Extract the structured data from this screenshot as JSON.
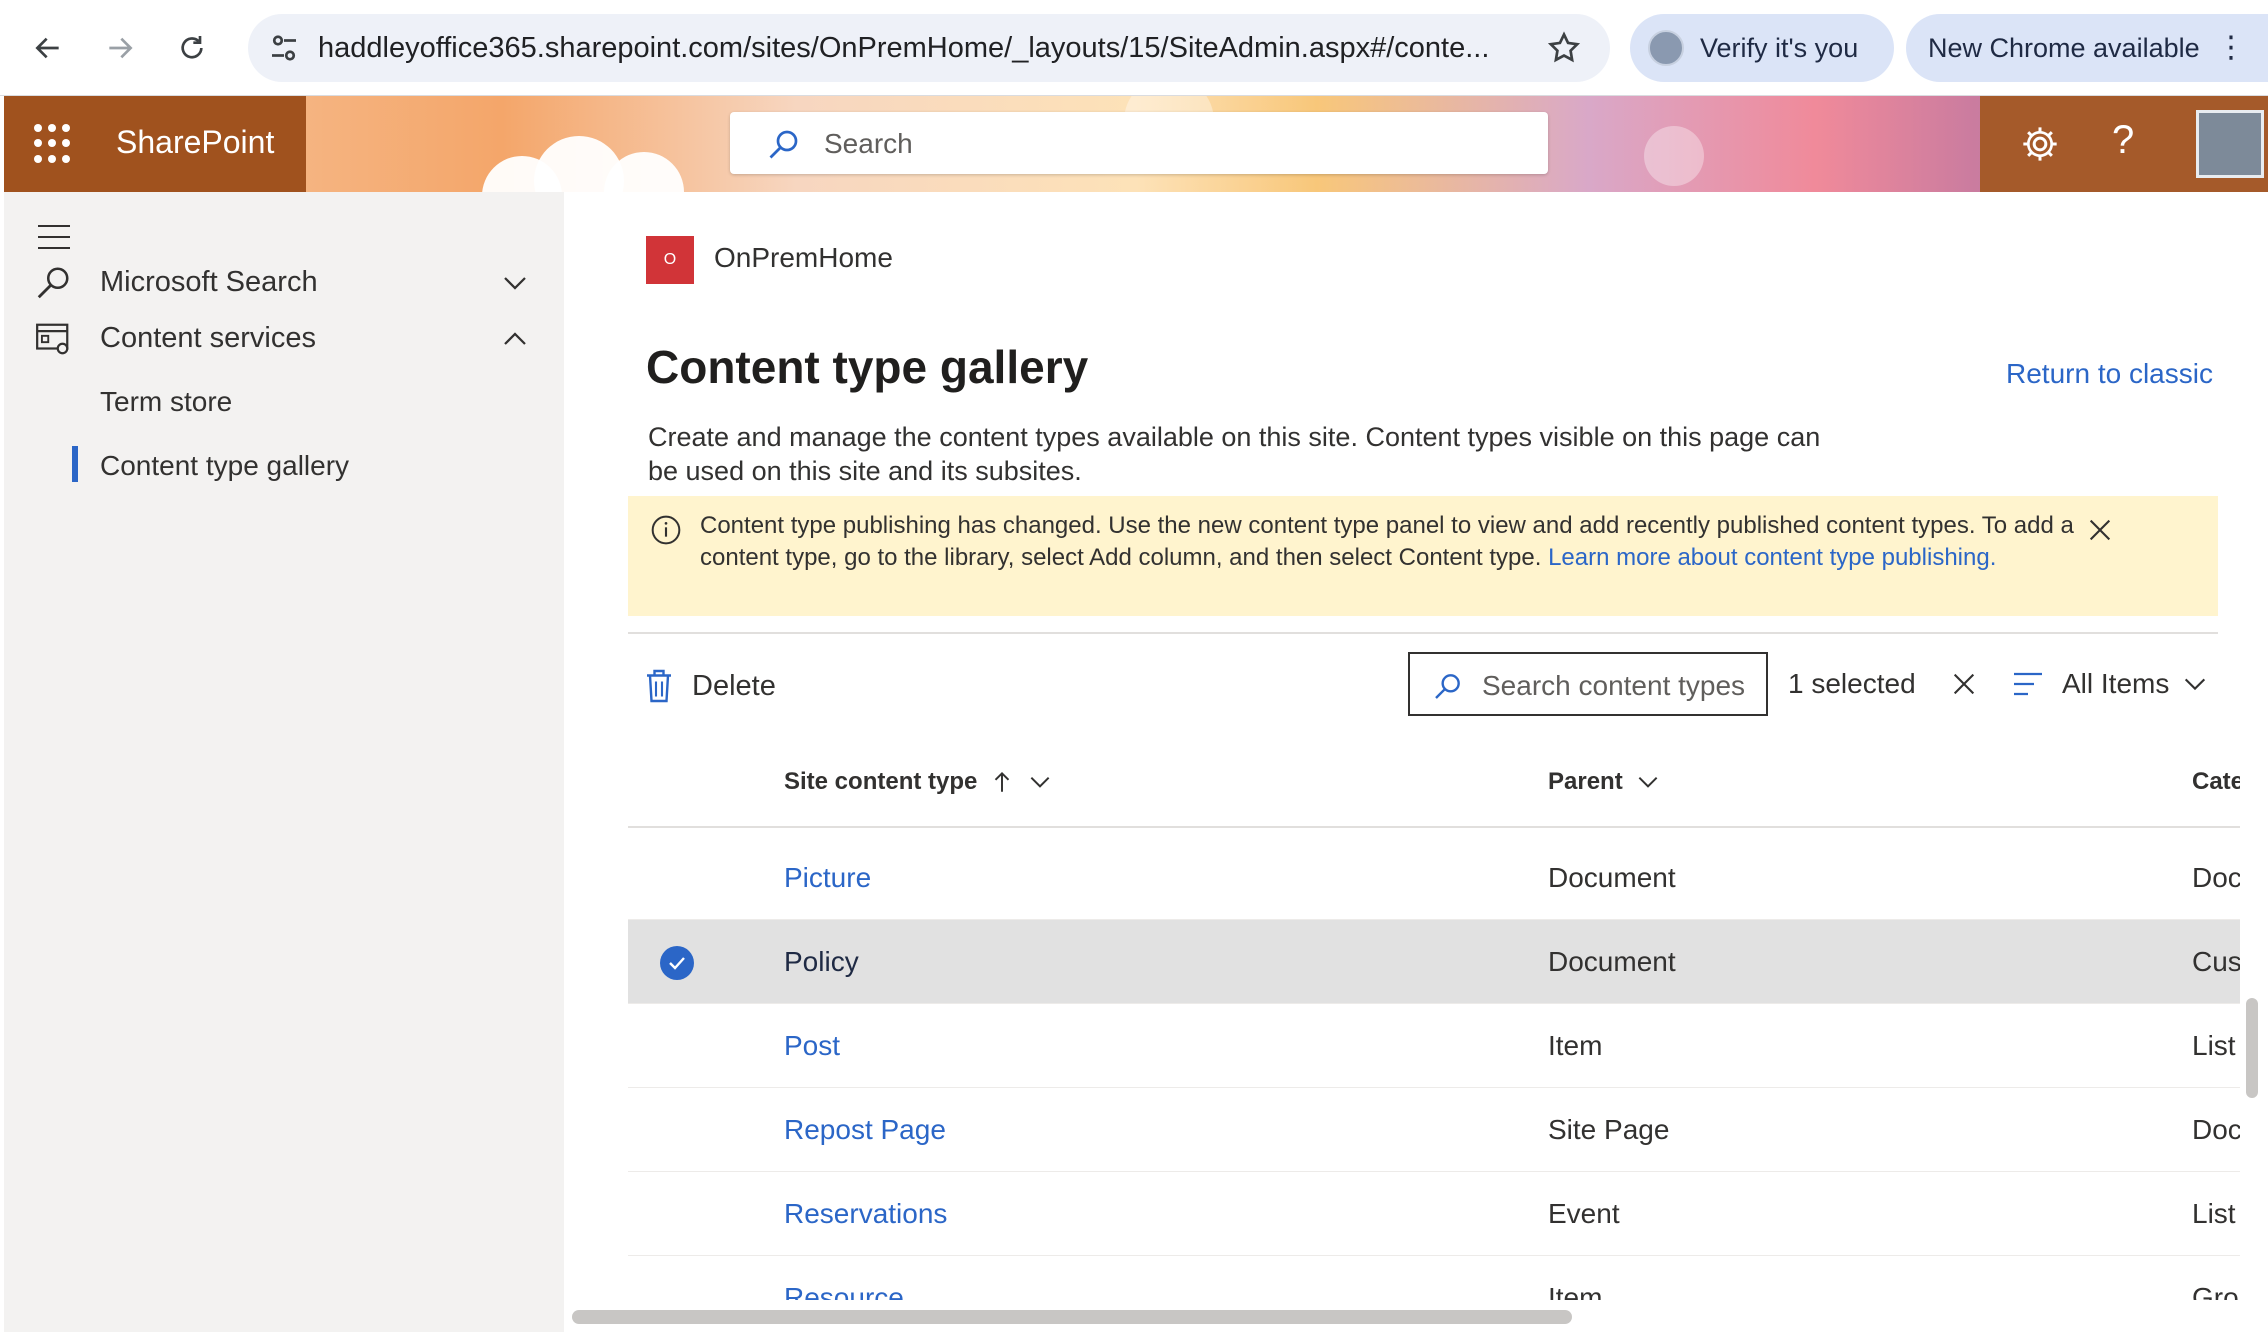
{
  "browser": {
    "url": "haddleyoffice365.sharepoint.com/sites/OnPremHome/_layouts/15/SiteAdmin.aspx#/conte...",
    "verify_label": "Verify it's you",
    "new_chrome_label": "New Chrome available"
  },
  "suite": {
    "brand": "SharePoint",
    "search_placeholder": "Search",
    "help_glyph": "?"
  },
  "leftnav": {
    "items": [
      {
        "label": "Microsoft Search",
        "icon": "search-icon",
        "expanded": false
      },
      {
        "label": "Content services",
        "icon": "content-services-icon",
        "expanded": true
      }
    ],
    "subitems": [
      {
        "label": "Term store",
        "active": false
      },
      {
        "label": "Content type gallery",
        "active": true
      }
    ]
  },
  "site": {
    "logo_letter": "O",
    "name": "OnPremHome"
  },
  "page": {
    "title": "Content type gallery",
    "return_link": "Return to classic",
    "description": "Create and manage the content types available on this site. Content types visible on this page can be used on this site and its subsites."
  },
  "banner": {
    "text": "Content type publishing has changed. Use the new content type panel to view and add recently published content types. To add a content type, go to the library, select Add column, and then select Content type. ",
    "link": "Learn more about content type publishing."
  },
  "commands": {
    "delete_label": "Delete",
    "search_placeholder": "Search content types",
    "selected_label": "1 selected",
    "view_label": "All Items"
  },
  "table": {
    "columns": [
      "Site content type",
      "Parent",
      "Category"
    ],
    "rows": [
      {
        "name": "Picture",
        "parent": "Document",
        "category": "Document Co",
        "selected": false
      },
      {
        "name": "Policy",
        "parent": "Document",
        "category": "Custom Conte",
        "selected": true
      },
      {
        "name": "Post",
        "parent": "Item",
        "category": "List Content T",
        "selected": false
      },
      {
        "name": "Repost Page",
        "parent": "Site Page",
        "category": "Document Co",
        "selected": false
      },
      {
        "name": "Reservations",
        "parent": "Event",
        "category": "List Content T",
        "selected": false
      },
      {
        "name": "Resource",
        "parent": "Item",
        "category": "Group Work C",
        "selected": false
      }
    ]
  },
  "colors": {
    "accent": "#2b66c7",
    "banner_bg": "#fff4ce",
    "selected_row": "#e1e1e1",
    "site_logo": "#d13438"
  }
}
